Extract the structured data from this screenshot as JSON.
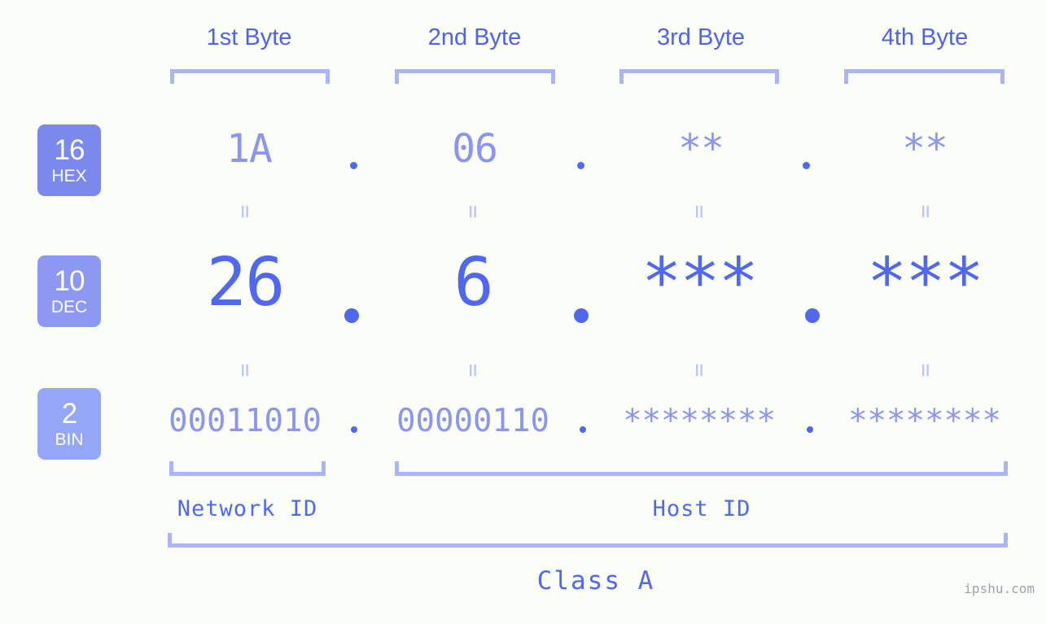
{
  "watermark": "ipshu.com",
  "colors": {
    "background": "#fbfdf9",
    "accent_strong": "#5068f0",
    "accent_light": "#8b95f0",
    "bracket": "#aab4fb",
    "equals": "#bcc4fb",
    "badge_hex": "#7b88ec",
    "badge_dec": "#8c99f2",
    "badge_bin": "#93a6f8",
    "badge_text": "#ffffff",
    "watermark": "#9aa2ab"
  },
  "header": {
    "byte_labels": [
      "1st Byte",
      "2nd Byte",
      "3rd Byte",
      "4th Byte"
    ]
  },
  "bases": [
    {
      "num": "16",
      "name": "HEX"
    },
    {
      "num": "10",
      "name": "DEC"
    },
    {
      "num": "2",
      "name": "BIN"
    }
  ],
  "rows": {
    "hex": {
      "base_num": "16",
      "base_name": "HEX",
      "values": [
        "1A",
        "06",
        "**",
        "**"
      ],
      "separator": "."
    },
    "dec": {
      "base_num": "10",
      "base_name": "DEC",
      "values": [
        "26",
        "6",
        "***",
        "***"
      ],
      "separator": "."
    },
    "bin": {
      "base_num": "2",
      "base_name": "BIN",
      "values": [
        "00011010",
        "00000110",
        "********",
        "********"
      ],
      "separator": "."
    }
  },
  "equals_marks": {
    "glyph": "=",
    "count_per_row": 4
  },
  "footer": {
    "network_id_label": "Network ID",
    "host_id_label": "Host ID",
    "class_label": "Class A"
  }
}
